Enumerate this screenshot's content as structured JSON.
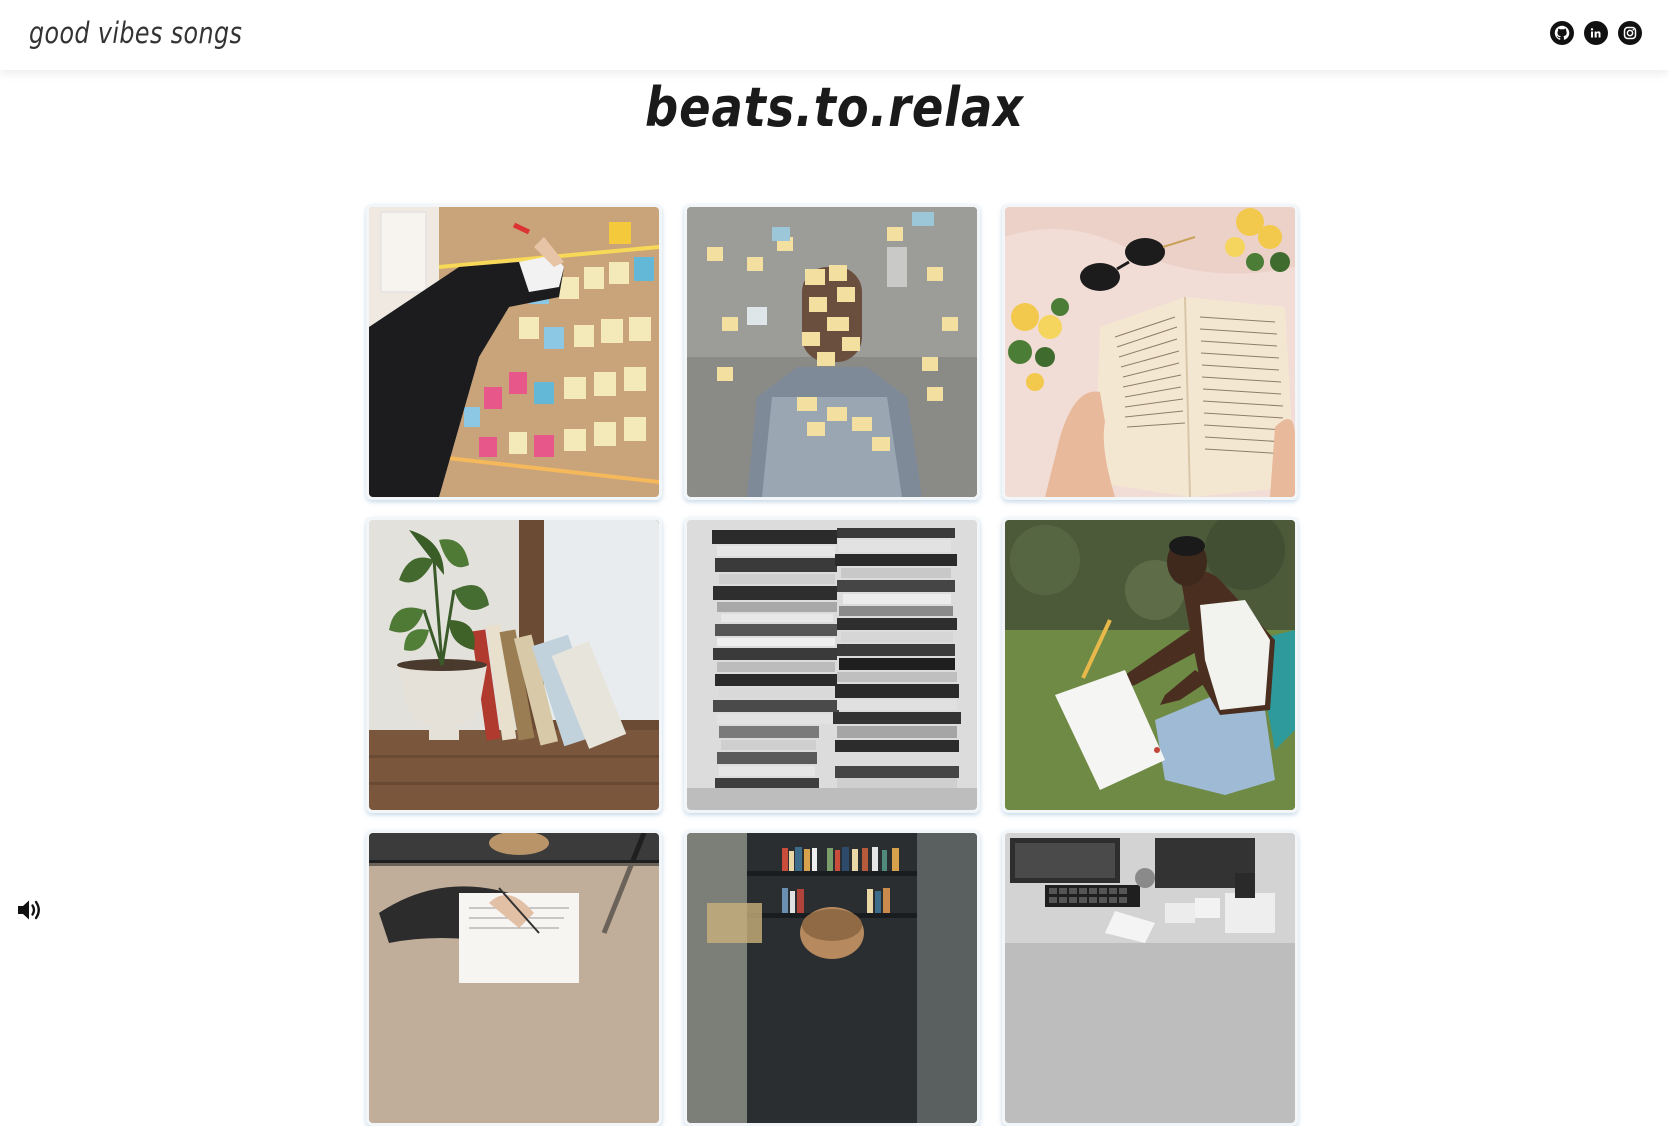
{
  "navbar": {
    "brand": "good vibes songs",
    "social": [
      {
        "name": "github-icon"
      },
      {
        "name": "linkedin-icon",
        "glyph": "in"
      },
      {
        "name": "instagram-icon"
      }
    ]
  },
  "main": {
    "title": "beats.to.relax",
    "tiles": [
      {
        "name": "sticky-notes-board-image"
      },
      {
        "name": "man-covered-in-sticky-notes-image"
      },
      {
        "name": "reading-book-with-sunglasses-image"
      },
      {
        "name": "plant-and-books-image"
      },
      {
        "name": "stacked-books-image"
      },
      {
        "name": "woman-writing-on-grass-image"
      },
      {
        "name": "writing-notebook-image"
      },
      {
        "name": "reading-in-library-image"
      },
      {
        "name": "desk-workspace-image"
      }
    ]
  },
  "controls": {
    "volume": "volume-icon"
  }
}
